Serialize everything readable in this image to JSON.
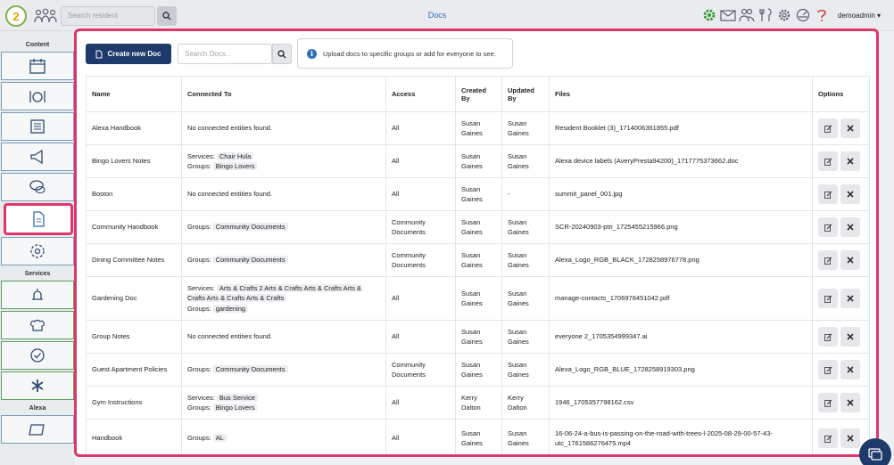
{
  "header": {
    "search_placeholder": "Search resident",
    "page_title": "Docs",
    "user_name": "demoadmin"
  },
  "sidebar": {
    "section_content": "Content",
    "section_services": "Services",
    "section_alexa": "Alexa"
  },
  "toolbar": {
    "create_label": "Create new Doc",
    "search_placeholder": "Search Docs...",
    "info_text": "Upload docs to specific groups or add for everyone to see."
  },
  "table": {
    "headers": {
      "name": "Name",
      "connected": "Connected To",
      "access": "Access",
      "created": "Created By",
      "updated": "Updated By",
      "files": "Files",
      "options": "Options"
    },
    "rows": [
      {
        "name": "Alexa Handbook",
        "c1k": "",
        "c1v": "No connected entities found.",
        "c2k": "",
        "c2v": "",
        "access": "All",
        "created": "Susan Gaines",
        "updated": "Susan Gaines",
        "file": "Resident Booklet (3)_1714006361855.pdf"
      },
      {
        "name": "Bingo Lovers Notes",
        "c1k": "Services:",
        "c1v": "Chair Hula",
        "c2k": "Groups:",
        "c2v": "Bingo Lovers",
        "access": "All",
        "created": "Susan Gaines",
        "updated": "Susan Gaines",
        "file": "Alexa device labels (AveryPresta94200)_1717775373662.doc"
      },
      {
        "name": "Boston",
        "c1k": "",
        "c1v": "No connected entities found.",
        "c2k": "",
        "c2v": "",
        "access": "All",
        "created": "Susan Gaines",
        "updated": "-",
        "file": "summit_panel_001.jpg"
      },
      {
        "name": "Community Handbook",
        "c1k": "Groups:",
        "c1v": "Community Documents",
        "c2k": "",
        "c2v": "",
        "access": "Community Documents",
        "created": "Susan Gaines",
        "updated": "Susan Gaines",
        "file": "SCR-20240903-ptri_1725455215966.png"
      },
      {
        "name": "Dining Committee Notes",
        "c1k": "Groups:",
        "c1v": "Community Documents",
        "c2k": "",
        "c2v": "",
        "access": "Community Documents",
        "created": "Susan Gaines",
        "updated": "Susan Gaines",
        "file": "Alexa_Logo_RGB_BLACK_1728258976778.png"
      },
      {
        "name": "Gardening Doc",
        "c1k": "Services:",
        "c1v": "Arts & Crafts 2  Arts & Crafts  Arts & Crafts  Arts & Crafts  Arts & Crafts  Arts & Crafts",
        "c2k": "Groups:",
        "c2v": "gardening",
        "access": "All",
        "created": "Susan Gaines",
        "updated": "Susan Gaines",
        "file": "manage-contacts_1706978451042.pdf"
      },
      {
        "name": "Group Notes",
        "c1k": "",
        "c1v": "No connected entities found.",
        "c2k": "",
        "c2v": "",
        "access": "All",
        "created": "Susan Gaines",
        "updated": "Susan Gaines",
        "file": "everyone 2_1705354999347.ai"
      },
      {
        "name": "Guest Apartment Policies",
        "c1k": "Groups:",
        "c1v": "Community Documents",
        "c2k": "",
        "c2v": "",
        "access": "Community Documents",
        "created": "Susan Gaines",
        "updated": "Susan Gaines",
        "file": "Alexa_Logo_RGB_BLUE_1728258919303.png"
      },
      {
        "name": "Gym Instructions",
        "c1k": "Services:",
        "c1v": "Bus Service",
        "c2k": "Groups:",
        "c2v": "Bingo Lovers",
        "access": "All",
        "created": "Kerry Dalton",
        "updated": "Kerry Dalton",
        "file": "1946_1705357798162.csv"
      },
      {
        "name": "Handbook",
        "c1k": "Groups:",
        "c1v": "AL",
        "c2k": "",
        "c2v": "",
        "access": "All",
        "created": "Susan Gaines",
        "updated": "Susan Gaines",
        "file": "16-06-24-a-bus-is-passing-on-the-road-with-trees-l-2025-08-29-00-57-43-utc_1761586276475.mp4"
      }
    ]
  }
}
